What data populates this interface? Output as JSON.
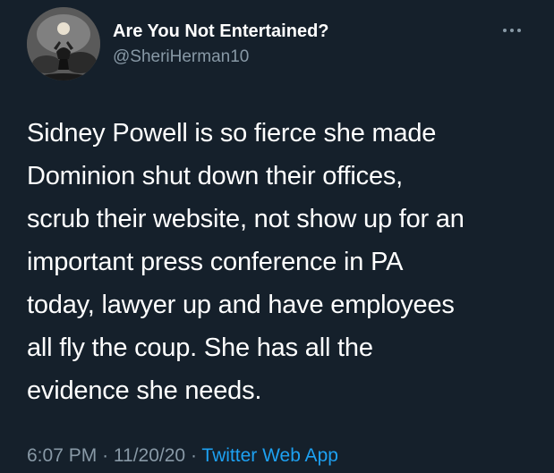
{
  "user": {
    "display_name": "Are You Not Entertained?",
    "handle": "@SheriHerman10",
    "avatar_icon": "profile-photo"
  },
  "more_icon": "more-options-icon",
  "tweet": {
    "lines": [
      "Sidney Powell is so fierce she made",
      "Dominion shut down their offices,",
      "scrub their website, not show up for an",
      "important press conference in PA",
      "today, lawyer up and have employees",
      "all fly the coup. She has all the",
      "evidence she needs."
    ]
  },
  "meta": {
    "time": "6:07 PM",
    "separator": "·",
    "date": "11/20/20",
    "source": "Twitter Web App"
  },
  "colors": {
    "background": "#15202b",
    "text": "#ffffff",
    "secondary": "#8899a6",
    "link": "#1da1f2"
  }
}
